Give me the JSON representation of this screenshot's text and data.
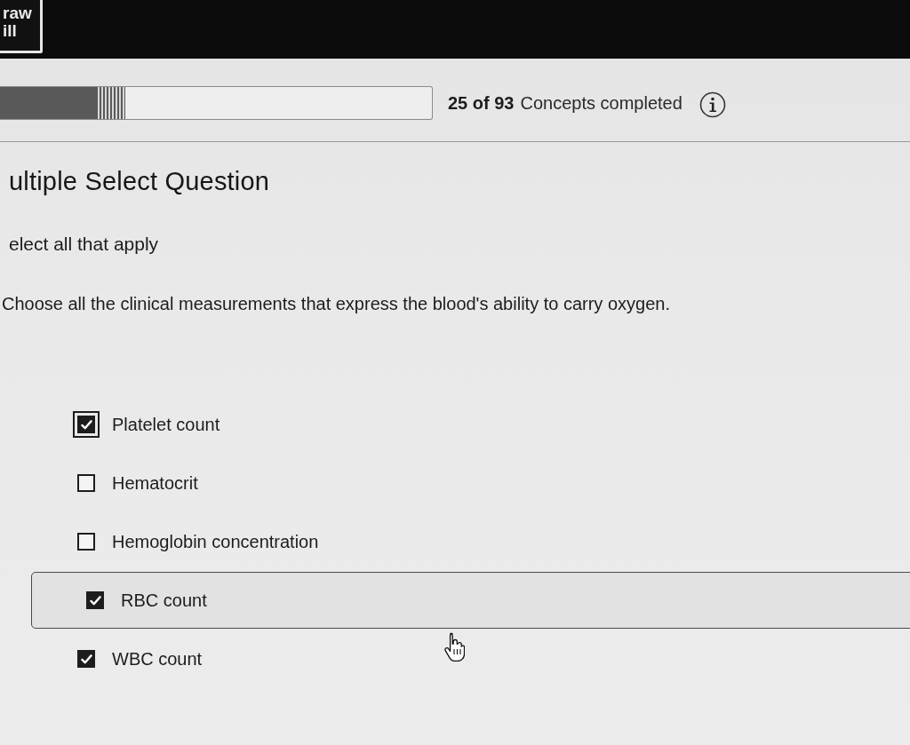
{
  "header": {
    "logo": {
      "lines": [
        "raw",
        "ill"
      ]
    }
  },
  "progress": {
    "level": 0.29,
    "count": "25 of 93",
    "label": "Concepts completed"
  },
  "question": {
    "type": "ultiple Select Question",
    "instruction": "elect all that apply",
    "prompt": "Choose all the clinical measurements that express the blood's ability to carry oxygen."
  },
  "options": [
    {
      "label": "Platelet count",
      "checked": true,
      "focused": true,
      "hovered": false
    },
    {
      "label": "Hematocrit",
      "checked": false,
      "focused": false,
      "hovered": false
    },
    {
      "label": "Hemoglobin concentration",
      "checked": false,
      "focused": false,
      "hovered": false
    },
    {
      "label": "RBC count",
      "checked": true,
      "focused": false,
      "hovered": true
    },
    {
      "label": "WBC count",
      "checked": true,
      "focused": false,
      "hovered": false
    }
  ]
}
